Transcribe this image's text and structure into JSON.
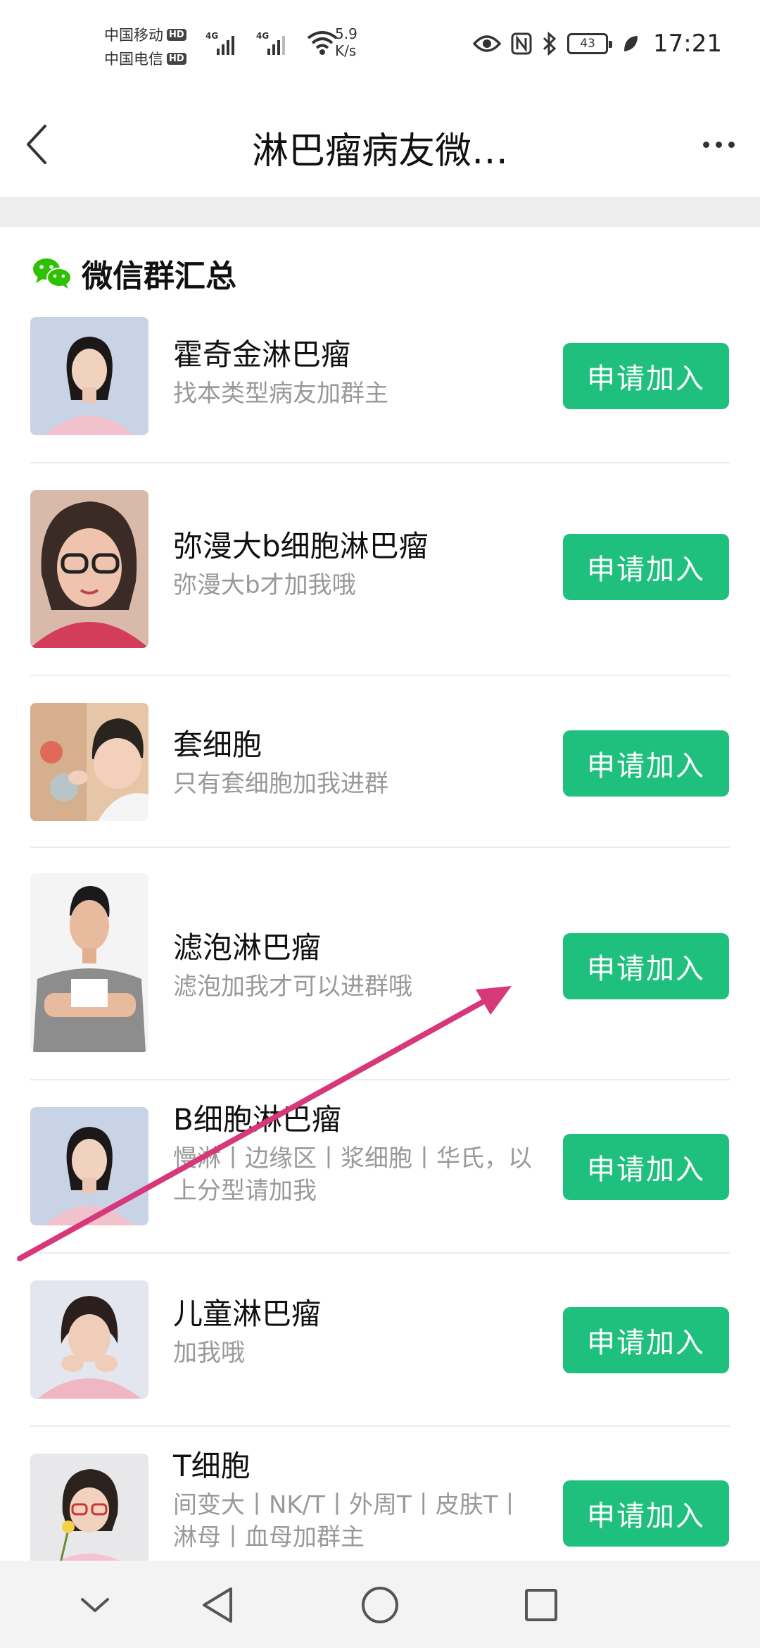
{
  "status_bar": {
    "carriers": [
      {
        "name": "中国移动",
        "badge": "HD"
      },
      {
        "name": "中国电信",
        "badge": "HD"
      }
    ],
    "signals": [
      {
        "tag": "4G"
      },
      {
        "tag": "4G"
      }
    ],
    "net_speed_value": "5.9",
    "net_speed_unit": "K/s",
    "battery": "43",
    "time": "17:21",
    "icons": [
      "eye-icon",
      "nfc-icon",
      "bluetooth-icon",
      "battery-icon",
      "leaf-icon"
    ]
  },
  "header": {
    "title": "淋巴瘤病友微…",
    "back_icon": "chevron-left-icon",
    "more_icon": "more-dots-icon"
  },
  "section": {
    "icon": "wechat-icon",
    "title": "微信群汇总"
  },
  "groups": [
    {
      "name": "霍奇金淋巴瘤",
      "desc": "找本类型病友加群主",
      "button": "申请加入"
    },
    {
      "name": "弥漫大b细胞淋巴瘤",
      "desc": "弥漫大b才加我哦",
      "button": "申请加入"
    },
    {
      "name": "套细胞",
      "desc": "只有套细胞加我进群",
      "button": "申请加入"
    },
    {
      "name": "滤泡淋巴瘤",
      "desc": "滤泡加我才可以进群哦",
      "button": "申请加入"
    },
    {
      "name": "B细胞淋巴瘤",
      "desc": "慢淋丨边缘区丨浆细胞丨华氏，以上分型请加我",
      "button": "申请加入"
    },
    {
      "name": "儿童淋巴瘤",
      "desc": "加我哦",
      "button": "申请加入"
    },
    {
      "name": "T细胞",
      "desc": "间变大丨NK/T丨外周T丨皮肤T丨淋母丨血母加群主",
      "button": "申请加入"
    }
  ],
  "bottom_nav": {
    "keys": [
      "collapse-icon",
      "back-triangle-icon",
      "home-circle-icon",
      "recents-square-icon"
    ]
  },
  "colors": {
    "accent": "#1fc07d",
    "annotation_arrow": "#d6387a",
    "desc_text": "#999999"
  }
}
